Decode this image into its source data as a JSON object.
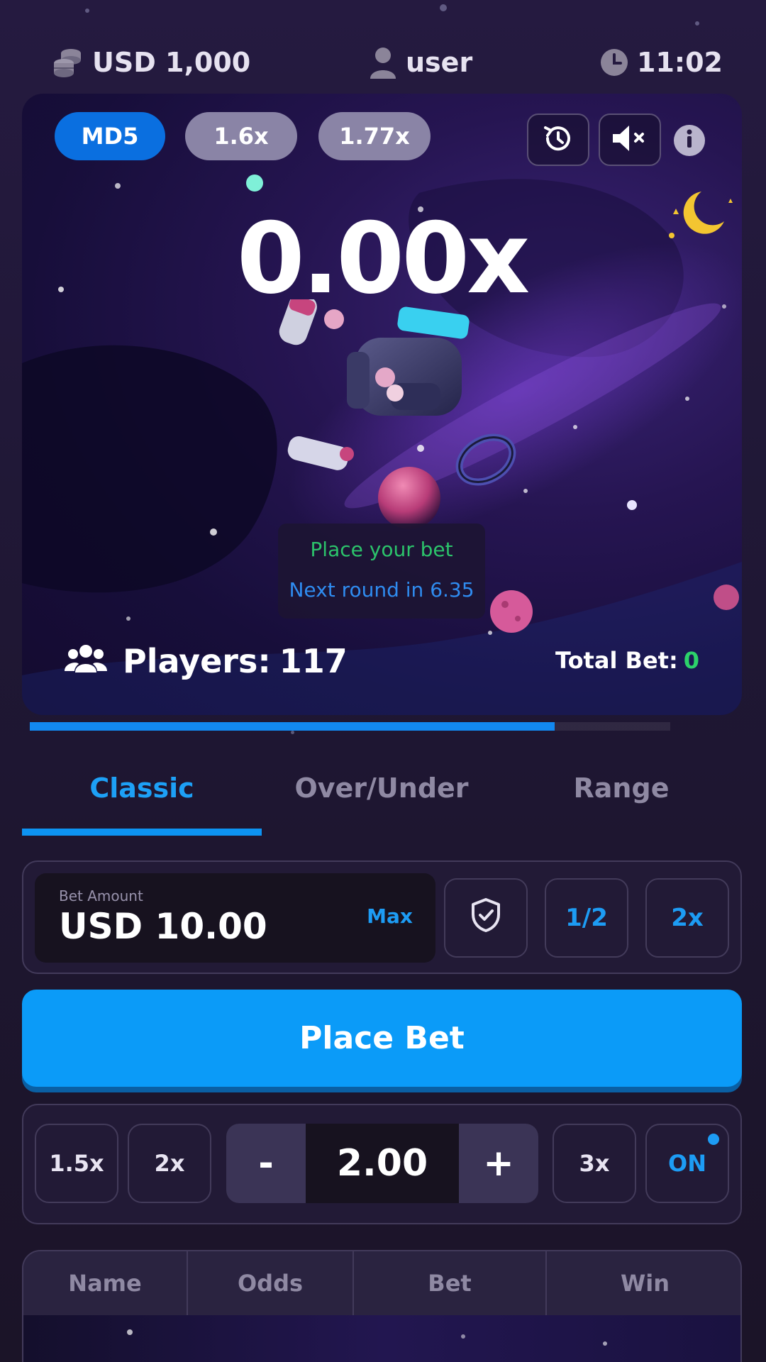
{
  "topbar": {
    "balance": "USD 1,000",
    "username": "user",
    "time": "11:02"
  },
  "game": {
    "chips": {
      "mode": "MD5",
      "history_1": "1.6x",
      "history_2": "1.77x"
    },
    "multiplier": "0.00x",
    "status_line1": "Place your bet",
    "status_line2": "Next round in 6.35",
    "players_label": "Players:",
    "players_count": "117",
    "total_bet_label": "Total Bet:",
    "total_bet_value": "0",
    "round_progress": 0.82
  },
  "tabs": {
    "classic": "Classic",
    "over_under": "Over/Under",
    "range": "Range",
    "active": "Classic"
  },
  "bet": {
    "label": "Bet Amount",
    "value": "USD 10.00",
    "max": "Max",
    "half": "1/2",
    "double": "2x"
  },
  "place_bet": "Place Bet",
  "auto": {
    "preset_1": "1.5x",
    "preset_2": "2x",
    "minus": "-",
    "value": "2.00",
    "plus": "+",
    "preset_3": "3x",
    "toggle": "ON"
  },
  "table": {
    "headers": [
      "Name",
      "Odds",
      "Bet",
      "Win"
    ]
  },
  "colors": {
    "accent": "#0b9bf8",
    "chip_active": "#0a6fe0",
    "status_green": "#2cc36b",
    "status_blue": "#2f8cf0",
    "total_bet_green": "#2cd26a"
  },
  "icons": [
    "coins-icon",
    "user-icon",
    "clock-icon",
    "history-icon",
    "mute-icon",
    "info-icon",
    "players-icon",
    "shield-check-icon"
  ]
}
